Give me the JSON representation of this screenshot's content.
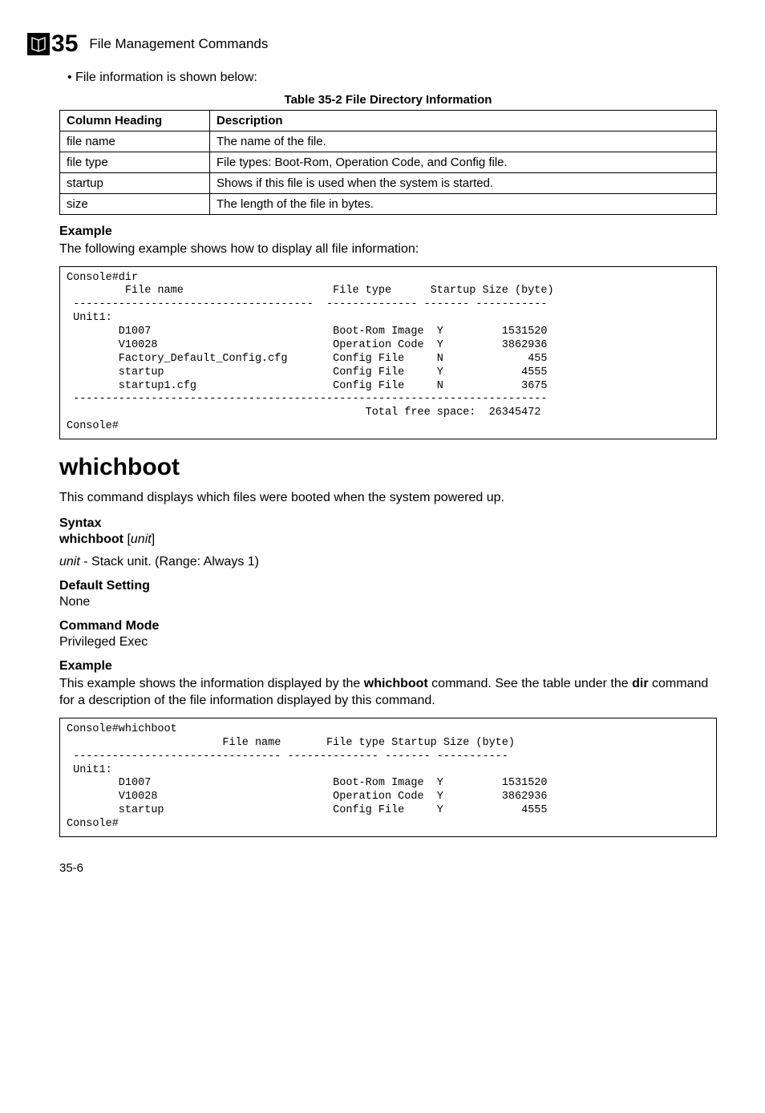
{
  "chapter": {
    "num3": "3",
    "num5": "5",
    "title": "File Management Commands"
  },
  "bullet": "File information is shown below:",
  "table": {
    "caption": "Table 35-2  File Directory Information",
    "head_col": "Column Heading",
    "head_desc": "Description",
    "rows": [
      {
        "c": "file name",
        "d": "The name of the file."
      },
      {
        "c": "file type",
        "d": "File types: Boot-Rom, Operation Code, and Config file."
      },
      {
        "c": "startup",
        "d": "Shows if this file is used when the system is started."
      },
      {
        "c": "size",
        "d": "The length of the file in bytes."
      }
    ]
  },
  "example1": {
    "heading": "Example",
    "intro": "The following example shows how to display all file information:",
    "console": "Console#dir\n         File name                       File type      Startup Size (byte)\n -------------------------------------  -------------- ------- -----------\n Unit1:\n        D1007                            Boot-Rom Image  Y         1531520\n        V10028                           Operation Code  Y         3862936\n        Factory_Default_Config.cfg       Config File     N             455\n        startup                          Config File     Y            4555\n        startup1.cfg                     Config File     N            3675\n -------------------------------------------------------------------------\n                                              Total free space:  26345472\nConsole#"
  },
  "whichboot": {
    "title": "whichboot",
    "desc": "This command displays which files were booted when the system powered up.",
    "syntax_heading": "Syntax",
    "syntax_cmd": "whichboot",
    "syntax_arg": "unit",
    "unit_lbl": "unit",
    "unit_desc": " - Stack unit. (Range: Always 1)",
    "default_heading": "Default Setting",
    "default_val": "None",
    "mode_heading": "Command Mode",
    "mode_val": "Privileged Exec",
    "example_heading": "Example",
    "example_intro_1": "This example shows the information displayed by the ",
    "example_intro_bold1": "whichboot",
    "example_intro_2": " command. See the table under the ",
    "example_intro_bold2": "dir",
    "example_intro_3": " command for a description of the file information displayed by this command.",
    "console": "Console#whichboot\n                        File name       File type Startup Size (byte)\n -------------------------------- -------------- ------- -----------\n Unit1:\n        D1007                            Boot-Rom Image  Y         1531520\n        V10028                           Operation Code  Y         3862936\n        startup                          Config File     Y            4555\nConsole#"
  },
  "footer": "35-6"
}
